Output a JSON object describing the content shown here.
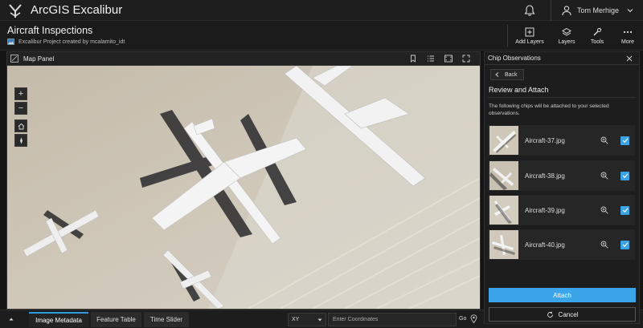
{
  "app": {
    "title": "ArcGIS Excalibur"
  },
  "user": {
    "name": "Tom Merhige"
  },
  "project": {
    "title": "Aircraft Inspections",
    "subtitle": "Excalibur Project created by mcalamito_idt"
  },
  "toolbar": [
    {
      "label": "Add Layers",
      "icon": "add-layers-icon"
    },
    {
      "label": "Layers",
      "icon": "layers-icon"
    },
    {
      "label": "Tools",
      "icon": "tools-icon"
    },
    {
      "label": "More",
      "icon": "more-icon"
    }
  ],
  "map_panel": {
    "title": "Map Panel",
    "zoom_in": "+",
    "zoom_out": "−"
  },
  "bottom": {
    "tabs": [
      "Image Metadata",
      "Feature Table",
      "Time Slider"
    ],
    "active_tab": "Image Metadata",
    "coord_system": "XY",
    "coord_placeholder": "Enter Coordinates",
    "go_label": "Go"
  },
  "panel": {
    "title": "Chip Observations",
    "back_label": "Back",
    "heading": "Review and Attach",
    "description": "The following chips will be attached to your selected observations.",
    "chips": [
      {
        "name": "Aircraft-37.jpg",
        "checked": true
      },
      {
        "name": "Aircraft-38.jpg",
        "checked": true
      },
      {
        "name": "Aircraft-39.jpg",
        "checked": true
      },
      {
        "name": "Aircraft-40.jpg",
        "checked": true
      }
    ],
    "attach_label": "Attach",
    "cancel_label": "Cancel"
  },
  "colors": {
    "accent": "#3ba5ea",
    "background": "#151515",
    "panel": "#1d1d1d"
  }
}
